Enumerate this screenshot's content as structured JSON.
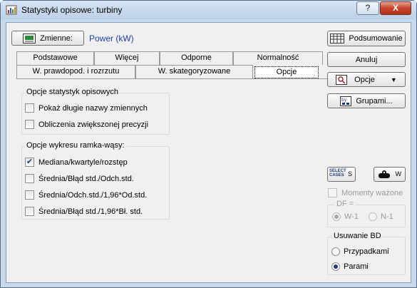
{
  "window": {
    "title": "Statystyki opisowe: turbiny",
    "help_label": "?",
    "close_label": "X"
  },
  "variables": {
    "button_label": "Zmienne:",
    "value": "Power (kW)"
  },
  "tabs": {
    "row1": [
      "Podstawowe",
      "Więcej",
      "Odporne",
      "Normalność"
    ],
    "row2": [
      "W. prawdopod. i rozrzutu",
      "W. skategoryzowane",
      "Opcje"
    ]
  },
  "options_group": {
    "title": "Opcje statystyk opisowych",
    "items": [
      {
        "label": "Pokaż długie nazwy zmiennych",
        "checked": false
      },
      {
        "label": "Obliczenia zwiększonej precyzji",
        "checked": false
      }
    ]
  },
  "boxplot_group": {
    "title": "Opcje wykresu ramka-wąsy:",
    "items": [
      {
        "label": "Mediana/kwartyle/rozstęp",
        "checked": true
      },
      {
        "label": "Średnia/Błąd std./Odch.std.",
        "checked": false
      },
      {
        "label": "Średnia/Odch.std./1,96*Od.std.",
        "checked": false
      },
      {
        "label": "Średnia/Błąd std./1,96*Bł. std.",
        "checked": false
      }
    ]
  },
  "right_panel": {
    "summary_label": "Podsumowanie",
    "cancel_label": "Anuluj",
    "options_label": "Opcje",
    "options_arrow": "▼",
    "groups_label": "Grupami...",
    "select_cases_label": "SELECT CASES",
    "select_cases_key": "S",
    "weight_key": "W",
    "weights_label": "Momenty ważone",
    "df_label": "DF =",
    "df_options": [
      "W-1",
      "N-1"
    ],
    "missing_title": "Usuwanie BD",
    "missing_options": [
      "Przypadkami",
      "Parami"
    ],
    "missing_selected": "Parami"
  }
}
